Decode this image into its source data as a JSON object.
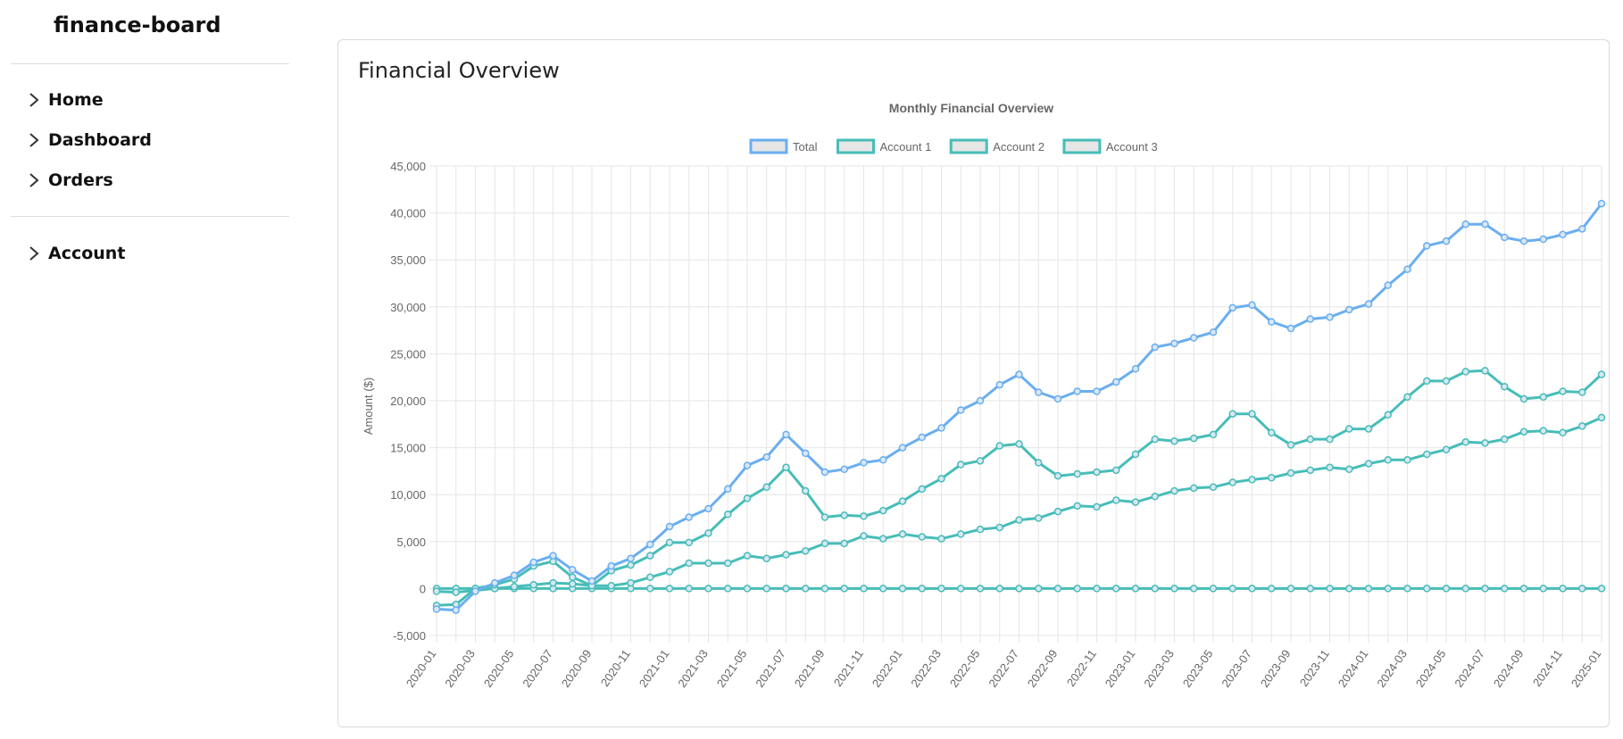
{
  "app": {
    "name": "finance-board"
  },
  "sidebar": {
    "items": [
      {
        "label": "Home"
      },
      {
        "label": "Dashboard"
      },
      {
        "label": "Orders"
      },
      {
        "label": "Account"
      }
    ]
  },
  "card": {
    "title": "Financial Overview"
  },
  "colors": {
    "total": "#6aaef0",
    "account": "#47bdb8",
    "grid": "#e6e6e6",
    "text": "#666666"
  },
  "chart_data": {
    "type": "line",
    "title": "Monthly Financial Overview",
    "ylabel": "Amount ($)",
    "xlabel": "",
    "ylim": [
      -5000,
      45000
    ],
    "yticks": [
      "45,000",
      "40,000",
      "35,000",
      "30,000",
      "25,000",
      "20,000",
      "15,000",
      "10,000",
      "5,000",
      "0",
      "-5,000"
    ],
    "grid": true,
    "legend": "top-center",
    "x": [
      "2020-01",
      "2020-02",
      "2020-03",
      "2020-04",
      "2020-05",
      "2020-06",
      "2020-07",
      "2020-08",
      "2020-09",
      "2020-10",
      "2020-11",
      "2020-12",
      "2021-01",
      "2021-02",
      "2021-03",
      "2021-04",
      "2021-05",
      "2021-06",
      "2021-07",
      "2021-08",
      "2021-09",
      "2021-10",
      "2021-11",
      "2021-12",
      "2022-01",
      "2022-02",
      "2022-03",
      "2022-04",
      "2022-05",
      "2022-06",
      "2022-07",
      "2022-08",
      "2022-09",
      "2022-10",
      "2022-11",
      "2022-12",
      "2023-01",
      "2023-02",
      "2023-03",
      "2023-04",
      "2023-05",
      "2023-06",
      "2023-07",
      "2023-08",
      "2023-09",
      "2023-10",
      "2023-11",
      "2023-12",
      "2024-01",
      "2024-02",
      "2024-03",
      "2024-04",
      "2024-05",
      "2024-06",
      "2024-07",
      "2024-08",
      "2024-09",
      "2024-10",
      "2024-11",
      "2024-12",
      "2025-01"
    ],
    "xticks": [
      "2020-01",
      "2020-03",
      "2020-05",
      "2020-07",
      "2020-09",
      "2020-11",
      "2021-01",
      "2021-03",
      "2021-05",
      "2021-07",
      "2021-09",
      "2021-11",
      "2022-01",
      "2022-03",
      "2022-05",
      "2022-07",
      "2022-09",
      "2022-11",
      "2023-01",
      "2023-03",
      "2023-05",
      "2023-07",
      "2023-09",
      "2023-11",
      "2024-01",
      "2024-03",
      "2024-05",
      "2024-07",
      "2024-09",
      "2024-11",
      "2025-01"
    ],
    "series": [
      {
        "name": "Total",
        "color": "#6aaef0",
        "values": [
          -2200,
          -2300,
          -300,
          600,
          1400,
          2800,
          3500,
          2000,
          800,
          2400,
          3200,
          4700,
          6600,
          7600,
          8500,
          10600,
          13100,
          14000,
          16400,
          14400,
          12400,
          12700,
          13400,
          13700,
          15000,
          16100,
          17100,
          19000,
          20000,
          21700,
          22800,
          20900,
          20200,
          21000,
          21000,
          22000,
          23400,
          25700,
          26100,
          26700,
          27300,
          29900,
          30200,
          28400,
          27700,
          28700,
          28900,
          29700,
          30300,
          32300,
          34000,
          36500,
          37000,
          38800,
          38800,
          37400,
          37000,
          37200,
          37700,
          38300,
          41000
        ]
      },
      {
        "name": "Account 1",
        "color": "#47bdb8",
        "values": [
          -1800,
          -1700,
          0,
          400,
          1000,
          2400,
          2900,
          1200,
          300,
          1900,
          2500,
          3500,
          4900,
          4900,
          5900,
          7900,
          9600,
          10800,
          12900,
          10400,
          7600,
          7800,
          7700,
          8300,
          9300,
          10600,
          11700,
          13200,
          13600,
          15200,
          15400,
          13400,
          12000,
          12200,
          12400,
          12600,
          14300,
          15900,
          15700,
          16000,
          16400,
          18600,
          18600,
          16600,
          15300,
          15900,
          15900,
          17000,
          17000,
          18500,
          20400,
          22100,
          22100,
          23100,
          23200,
          21500,
          20200,
          20400,
          21000,
          20900,
          22800
        ]
      },
      {
        "name": "Account 2",
        "color": "#47bdb8",
        "values": [
          -300,
          -400,
          -200,
          0,
          200,
          400,
          600,
          500,
          300,
          300,
          600,
          1200,
          1800,
          2700,
          2700,
          2700,
          3500,
          3200,
          3600,
          4000,
          4800,
          4800,
          5600,
          5300,
          5800,
          5500,
          5300,
          5800,
          6300,
          6500,
          7300,
          7500,
          8200,
          8800,
          8700,
          9400,
          9200,
          9800,
          10400,
          10700,
          10800,
          11300,
          11600,
          11800,
          12300,
          12600,
          12900,
          12700,
          13300,
          13700,
          13700,
          14300,
          14800,
          15600,
          15500,
          15900,
          16700,
          16800,
          16600,
          17300,
          18200
        ]
      },
      {
        "name": "Account 3",
        "color": "#47bdb8",
        "values": [
          0,
          0,
          0,
          0,
          0,
          0,
          0,
          0,
          0,
          0,
          0,
          0,
          0,
          0,
          0,
          0,
          0,
          0,
          0,
          0,
          0,
          0,
          0,
          0,
          0,
          0,
          0,
          0,
          0,
          0,
          0,
          0,
          0,
          0,
          0,
          0,
          0,
          0,
          0,
          0,
          0,
          0,
          0,
          0,
          0,
          0,
          0,
          0,
          0,
          0,
          0,
          0,
          0,
          0,
          0,
          0,
          0,
          0,
          0,
          0,
          0
        ]
      }
    ]
  }
}
